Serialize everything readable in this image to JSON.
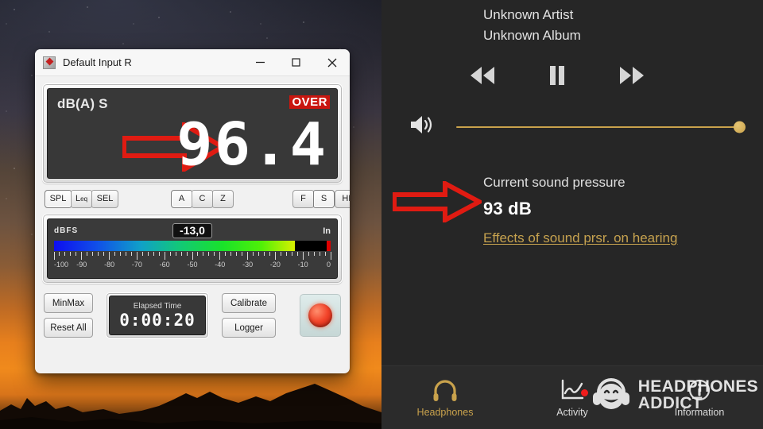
{
  "meter_app": {
    "window_title": "Default Input R",
    "icon": "app-icon",
    "window_buttons": {
      "minimize": "minimize-icon",
      "maximize": "maximize-icon",
      "close": "close-icon"
    },
    "display": {
      "weighting_label": "dB(A) S",
      "over_label": "OVER",
      "value": "96.4",
      "arrow": "red-arrow-pointer"
    },
    "mode_buttons": [
      {
        "label": "SPL",
        "active": true
      },
      {
        "label": "L",
        "sub": "eq",
        "active": false
      },
      {
        "label": "SEL",
        "active": false
      }
    ],
    "weighting_buttons": [
      {
        "label": "A",
        "active": true
      },
      {
        "label": "C",
        "active": false
      },
      {
        "label": "Z",
        "active": false
      }
    ],
    "response_buttons": [
      {
        "label": "F",
        "active": false
      },
      {
        "label": "S",
        "active": true
      }
    ],
    "filter_button": {
      "label": "HP",
      "active": false
    },
    "input_meter": {
      "unit_label": "dBFS",
      "input_label": "In",
      "peak_value": "-13,0",
      "scale_min": -100,
      "scale_max": 0,
      "fill_percent": 87,
      "scale_labels": [
        "-100",
        "-90",
        "-80",
        "-70",
        "-60",
        "-50",
        "-40",
        "-30",
        "-20",
        "-10",
        "0"
      ]
    },
    "controls": {
      "minmax_label": "MinMax",
      "reset_label": "Reset All",
      "calibrate_label": "Calibrate",
      "logger_label": "Logger",
      "record_button": "record-button"
    },
    "elapsed": {
      "label": "Elapsed Time",
      "value": "0:00:20"
    }
  },
  "player": {
    "artist": "Unknown Artist",
    "album": "Unknown Album",
    "transport": {
      "previous": "rewind-icon",
      "play_pause": "pause-icon",
      "next": "fast-forward-icon"
    },
    "volume": {
      "icon": "speaker-icon",
      "level_percent": 100
    },
    "sound_pressure": {
      "title": "Current sound pressure",
      "value": "93 dB",
      "link_label": "Effects of sound prsr. on hearing",
      "arrow": "red-arrow-pointer",
      "accent_color": "#c6a24f"
    },
    "nav": [
      {
        "label": "Headphones",
        "icon": "headphones-icon",
        "active": true,
        "badge": false
      },
      {
        "label": "Activity",
        "icon": "activity-chart-icon",
        "active": false,
        "badge": true
      },
      {
        "label": "Information",
        "icon": "information-icon",
        "active": false,
        "badge": false
      }
    ],
    "watermark": {
      "line1": "HEADPHONES",
      "line2": "ADDICT",
      "icon": "smiley-headphones-logo"
    }
  }
}
